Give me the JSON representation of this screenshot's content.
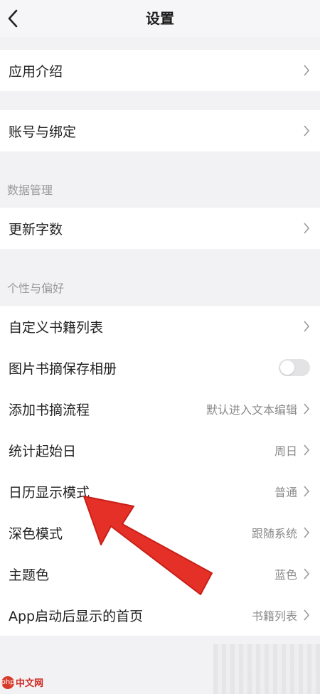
{
  "header": {
    "title": "设置"
  },
  "groups": {
    "intro": {
      "label": "应用介绍"
    },
    "account": {
      "label": "账号与绑定"
    },
    "data": {
      "section": "数据管理",
      "update_words": "更新字数"
    },
    "prefs": {
      "section": "个性与偏好",
      "items": [
        {
          "label": "自定义书籍列表",
          "value": ""
        },
        {
          "label": "图片书摘保存相册",
          "value": "",
          "toggle": false
        },
        {
          "label": "添加书摘流程",
          "value": "默认进入文本编辑"
        },
        {
          "label": "统计起始日",
          "value": "周日"
        },
        {
          "label": "日历显示模式",
          "value": "普通"
        },
        {
          "label": "深色模式",
          "value": "跟随系统"
        },
        {
          "label": "主题色",
          "value": "蓝色"
        },
        {
          "label": "App启动后显示的首页",
          "value": "书籍列表"
        }
      ]
    }
  },
  "annotation": {
    "arrow_color": "#e53028"
  },
  "watermark": {
    "text": "中文网",
    "logo": "php"
  }
}
